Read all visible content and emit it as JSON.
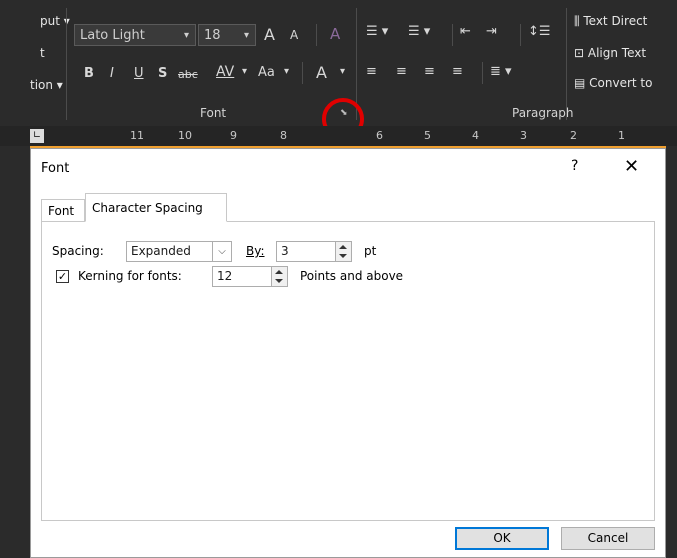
{
  "ribbon": {
    "left_partial": {
      "item1": "put ▾",
      "item2": "t",
      "item3": "tion ▾"
    },
    "font_group": {
      "font_name": "Lato Light",
      "font_size": "18",
      "grow": "A",
      "shrink": "A",
      "clear_format": "A",
      "bold": "B",
      "italic": "I",
      "underline": "U",
      "strike_s": "S",
      "strikethrough": "abc",
      "char_spacing": "AV",
      "change_case": "Aa",
      "font_color": "A",
      "label": "Font"
    },
    "paragraph_group": {
      "label": "Paragraph"
    },
    "right_items": {
      "text_direction": "Text Direct",
      "align_text": "Align Text",
      "convert_to": "Convert to"
    }
  },
  "ruler": {
    "ticks": [
      "11",
      "10",
      "9",
      "8",
      "6",
      "5",
      "4",
      "3",
      "2",
      "1"
    ]
  },
  "dialog": {
    "title": "Font",
    "help": "?",
    "close": "✕",
    "tabs": [
      {
        "label": "Font",
        "access_key_index": 2
      },
      {
        "label": "Character Spacing",
        "active": true
      }
    ],
    "spacing": {
      "label": "Spacing:",
      "value": "Expanded",
      "by_label": "By:",
      "by_value": "3",
      "by_unit": "pt"
    },
    "kerning": {
      "checked": true,
      "label": "Kerning for fonts:",
      "value": "12",
      "suffix": "Points and above"
    },
    "ok": "OK",
    "cancel": "Cancel"
  },
  "colors": {
    "ribbon_bg": "#2b2b2b",
    "annotation_circle": "#e00000",
    "default_button_border": "#0078d7"
  }
}
